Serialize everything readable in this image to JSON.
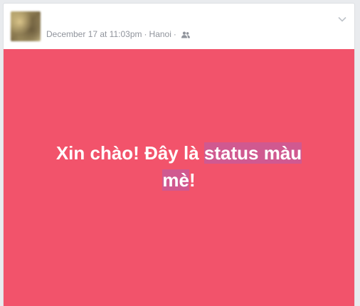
{
  "post": {
    "timestamp": "December 17 at 11:03pm",
    "separator": "·",
    "location": "Hanoi",
    "audience_icon": "friends-icon",
    "menu_icon": "chevron-down-icon",
    "avatar_icon": "avatar"
  },
  "status": {
    "text_plain": "Xin chào! Đây là ",
    "text_highlight_1": "status màu",
    "text_highlight_2": "mè",
    "text_end": "!",
    "background_color": "#f2536b",
    "text_color": "#ffffff",
    "highlight_color": "#b45faf"
  }
}
